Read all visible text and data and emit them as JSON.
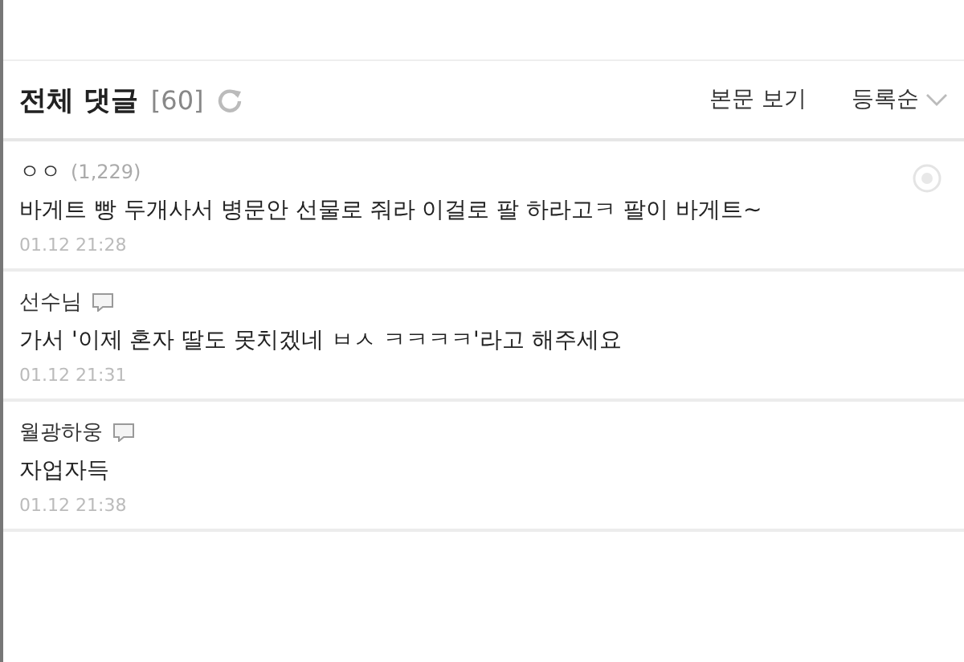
{
  "header": {
    "title": "전체 댓글",
    "count": "[60]",
    "view_link": "본문 보기",
    "sort": "등록순"
  },
  "comments": [
    {
      "kind": "count",
      "author": "ㅇㅇ",
      "count": "(1,229)",
      "text": "바게트 빵 두개사서 병문안 선물로 줘라 이걸로 팔 하라고ㅋ 팔이 바게트~",
      "time": "01.12 21:28"
    },
    {
      "kind": "blog",
      "author": "선수님",
      "text": "가서 '이제 혼자 딸도 못치겠네 ㅂㅅ ㅋㅋㅋㅋ'라고 해주세요",
      "time": "01.12 21:31"
    },
    {
      "kind": "blog",
      "author": "월광하웅",
      "text": "자업자득",
      "time": "01.12 21:38"
    }
  ]
}
